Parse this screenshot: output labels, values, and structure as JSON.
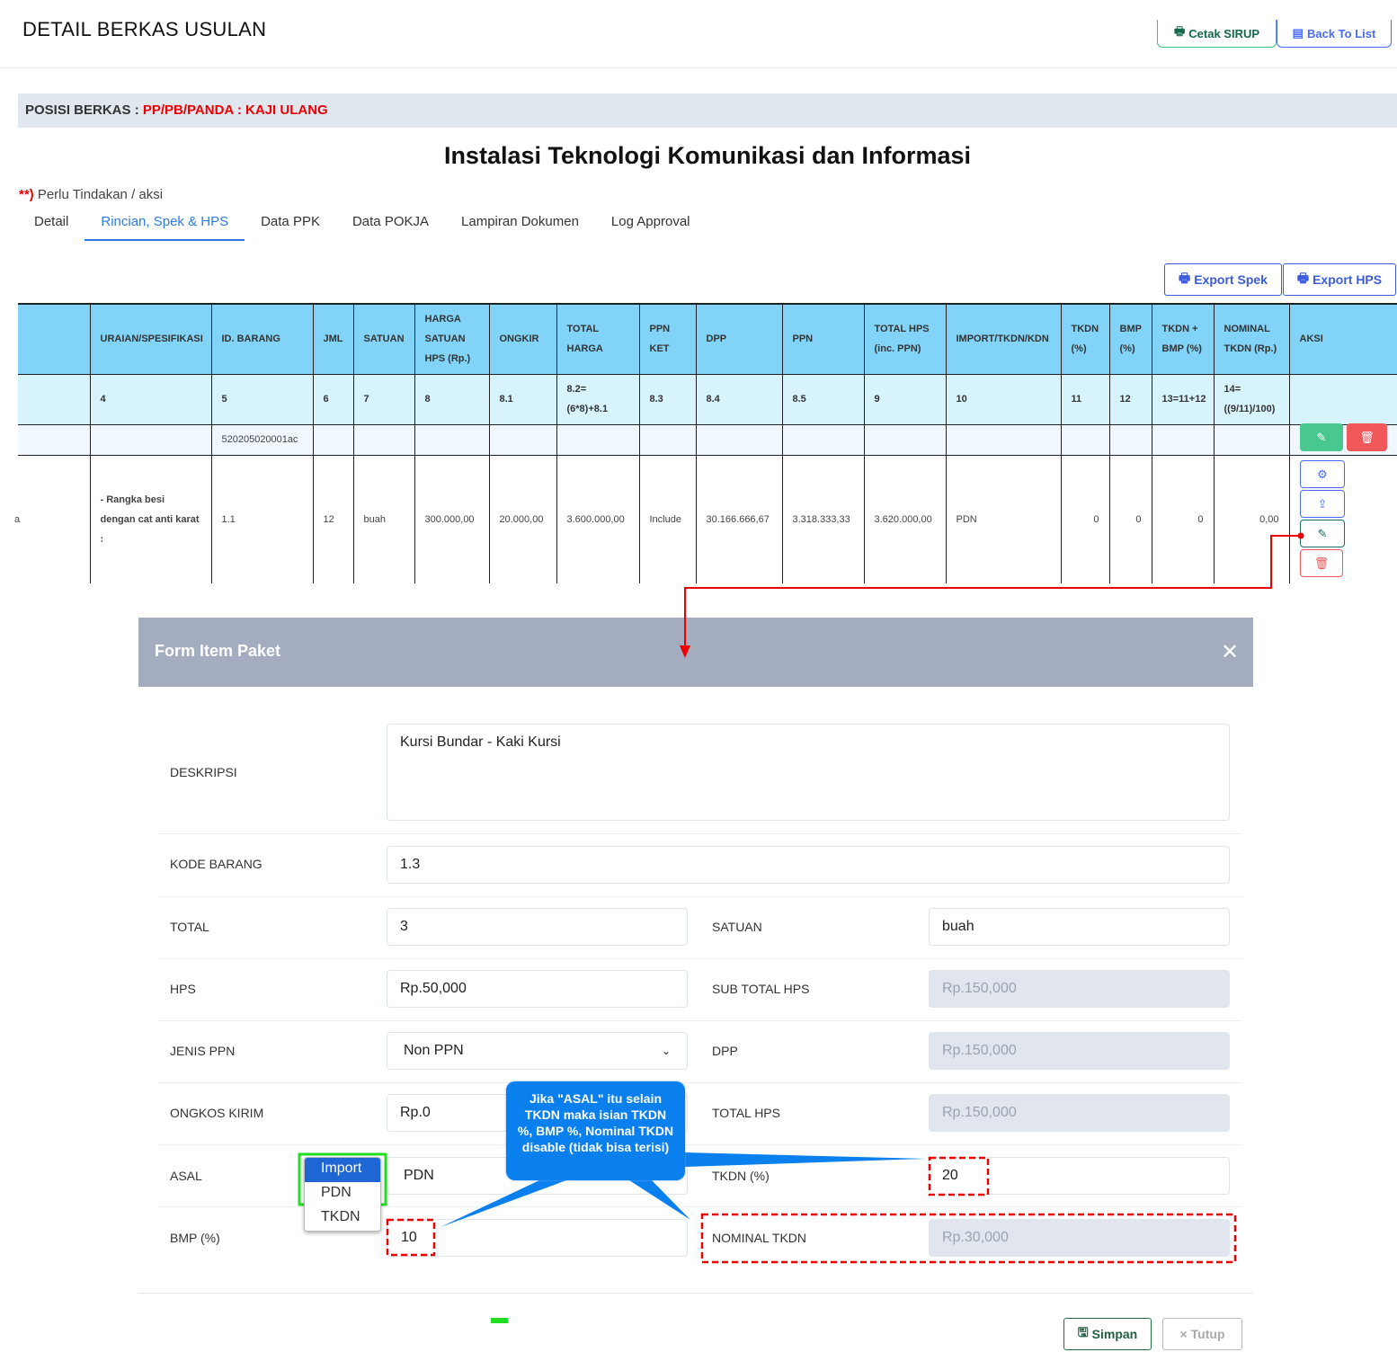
{
  "header": {
    "title": "DETAIL BERKAS USULAN",
    "cetak_label": "Cetak SIRUP",
    "back_label": "Back To List"
  },
  "posisi": {
    "label": "POSISI BERKAS :",
    "value": "PP/PB/PANDA : KAJI ULANG"
  },
  "page_heading": "Instalasi Teknologi Komunikasi dan Informasi",
  "note": {
    "marker": "**)",
    "text": " Perlu Tindakan / aksi"
  },
  "tabs": [
    {
      "label": "Detail"
    },
    {
      "label": "Rincian, Spek & HPS",
      "active": true
    },
    {
      "label": "Data PPK"
    },
    {
      "label": "Data POKJA"
    },
    {
      "label": "Lampiran Dokumen"
    },
    {
      "label": "Log Approval"
    }
  ],
  "export": {
    "spek": "Export Spek",
    "hps": "Export HPS"
  },
  "table": {
    "headers": [
      "",
      "URAIAN/SPESIFIKASI",
      "ID. BARANG",
      "JML",
      "SATUAN",
      "HARGA SATUAN HPS (Rp.)",
      "ONGKIR",
      "TOTAL HARGA",
      "PPN KET",
      "DPP",
      "PPN",
      "TOTAL HPS (inc. PPN)",
      "IMPORT/TKDN/KDN",
      "TKDN (%)",
      "BMP (%)",
      "TKDN + BMP (%)",
      "NOMINAL TKDN (Rp.)",
      "AKSI"
    ],
    "numbers": [
      "",
      "4",
      "5",
      "6",
      "7",
      "8",
      "8.1",
      "8.2= (6*8)+8.1",
      "8.3",
      "8.4",
      "8.5",
      "9",
      "10",
      "11",
      "12",
      "13=11+12",
      "14= ((9/11)/100)",
      ""
    ],
    "id_row": [
      "",
      "",
      "520205020001ac",
      "",
      "",
      "",
      "",
      "",
      "",
      "",
      "",
      "",
      "",
      "",
      "",
      "",
      "",
      ""
    ],
    "data_row": [
      "a",
      "- Rangka besi dengan cat anti karat :",
      "1.1",
      "12",
      "buah",
      "300.000,00",
      "20.000,00",
      "3.600.000,00",
      "Include",
      "30.166.666,67",
      "3.318.333,33",
      "3.620.000,00",
      "PDN",
      "0",
      "0",
      "0",
      "0,00",
      ""
    ]
  },
  "modal": {
    "title": "Form Item Paket",
    "fields": {
      "deskripsi": {
        "label": "DESKRIPSI",
        "value": "Kursi Bundar - Kaki Kursi"
      },
      "kode_barang": {
        "label": "KODE BARANG",
        "value": "1.3"
      },
      "total": {
        "label": "TOTAL",
        "value": "3"
      },
      "satuan": {
        "label": "SATUAN",
        "value": "buah"
      },
      "hps": {
        "label": "HPS",
        "value": "Rp.50,000"
      },
      "sub_total_hps": {
        "label": "SUB TOTAL HPS",
        "value": "Rp.150,000"
      },
      "jenis_ppn": {
        "label": "JENIS PPN",
        "value": "Non PPN"
      },
      "dpp": {
        "label": "DPP",
        "value": "Rp.150,000"
      },
      "ongkos_kirim": {
        "label": "ONGKOS KIRIM",
        "value": "Rp.0"
      },
      "total_hps": {
        "label": "TOTAL HPS",
        "value": "Rp.150,000"
      },
      "asal": {
        "label": "ASAL",
        "value": "PDN",
        "options": [
          "Import",
          "PDN",
          "TKDN"
        ]
      },
      "tkdn": {
        "label": "TKDN (%)",
        "value": "20"
      },
      "bmp": {
        "label": "BMP (%)",
        "value": "10"
      },
      "nominal_tkdn": {
        "label": "NOMINAL TKDN",
        "value": "Rp.30,000"
      }
    },
    "simpan_label": "Simpan",
    "tutup_label": "Tutup"
  },
  "annotation": {
    "callout": "Jika \"ASAL\" itu selain TKDN maka isian TKDN %, BMP %, Nominal TKDN disable (tidak bisa terisi)"
  },
  "colors": {
    "accent": "#2f7be5",
    "header_blue": "#81d4f7",
    "red": "#e00000",
    "callout": "#0a7fee"
  }
}
